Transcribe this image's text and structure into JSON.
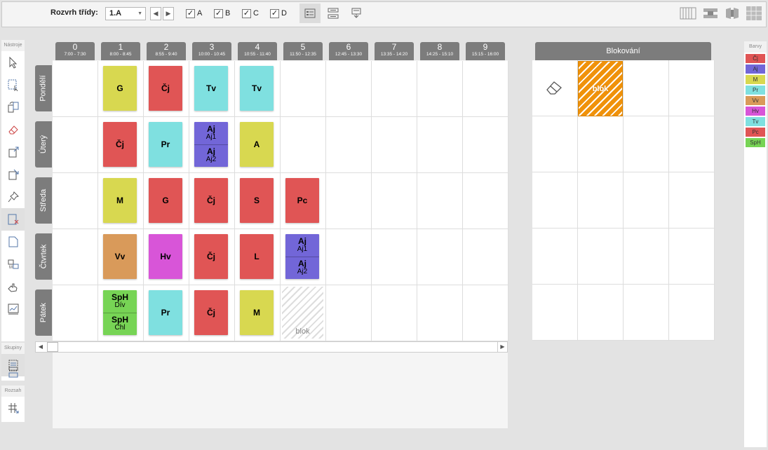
{
  "toolbar": {
    "label": "Rozvrh třídy:",
    "class_value": "1.A",
    "prev": "◀",
    "next": "▶",
    "checks": [
      {
        "label": "A",
        "checked": true
      },
      {
        "label": "B",
        "checked": true
      },
      {
        "label": "C",
        "checked": true
      },
      {
        "label": "D",
        "checked": true
      }
    ]
  },
  "palette": {
    "tools_title": "Nástroje",
    "groups_title": "Skupiny",
    "range_title": "Rozsah"
  },
  "columns": [
    {
      "n": "0",
      "t": "7:00 - 7:30"
    },
    {
      "n": "1",
      "t": "8:00 - 8:45"
    },
    {
      "n": "2",
      "t": "8:55 - 9:40"
    },
    {
      "n": "3",
      "t": "10:00 - 10:45"
    },
    {
      "n": "4",
      "t": "10:55 - 11:40"
    },
    {
      "n": "5",
      "t": "11:50 - 12:35"
    },
    {
      "n": "6",
      "t": "12:45 - 13:30"
    },
    {
      "n": "7",
      "t": "13:35 - 14:20"
    },
    {
      "n": "8",
      "t": "14:25 - 15:10"
    },
    {
      "n": "9",
      "t": "15:15 - 16:00"
    }
  ],
  "days": [
    "Pondělí",
    "Úterý",
    "Středa",
    "Čtvrtek",
    "Pátek"
  ],
  "lessons": {
    "mon": {
      "c1": "G",
      "c2": "Čj",
      "c3": "Tv",
      "c4": "Tv"
    },
    "tue": {
      "c1": "Čj",
      "c2": "Pr",
      "c3a": "Aj",
      "c3a_sub": "Aj1",
      "c3b": "Aj",
      "c3b_sub": "Aj2",
      "c4": "A"
    },
    "wed": {
      "c1": "M",
      "c2": "G",
      "c3": "Čj",
      "c4": "S",
      "c5": "Pc"
    },
    "thu": {
      "c1": "Vv",
      "c2": "Hv",
      "c3": "Čj",
      "c4": "L",
      "c5a": "Aj",
      "c5a_sub": "Aj1",
      "c5b": "Aj",
      "c5b_sub": "Aj2"
    },
    "fri": {
      "c1a": "SpH",
      "c1a_sub": "Dív",
      "c1b": "SpH",
      "c1b_sub": "Chl",
      "c2": "Pr",
      "c3": "Čj",
      "c4": "M",
      "c5": "blok"
    }
  },
  "blokovani": {
    "title": "Blokování",
    "blok_label": "blok"
  },
  "colors": {
    "title": "Barvy",
    "items": [
      {
        "label": "Čj",
        "color": "#e05555"
      },
      {
        "label": "Aj",
        "color": "#7266d8"
      },
      {
        "label": "M",
        "color": "#d8d850"
      },
      {
        "label": "Pr",
        "color": "#7fe0e0"
      },
      {
        "label": "Vv",
        "color": "#d99a5a"
      },
      {
        "label": "Hv",
        "color": "#d855d8"
      },
      {
        "label": "Tv",
        "color": "#7fe0e0"
      },
      {
        "label": "Pc",
        "color": "#e05555"
      },
      {
        "label": "SpH",
        "color": "#77d455"
      }
    ]
  },
  "subject_colors": {
    "red": "#e05555",
    "yellow": "#d8d850",
    "cyan": "#7fe0e0",
    "purple": "#7266d8",
    "orange": "#d99a5a",
    "magenta": "#d855d8",
    "green": "#77d455"
  }
}
